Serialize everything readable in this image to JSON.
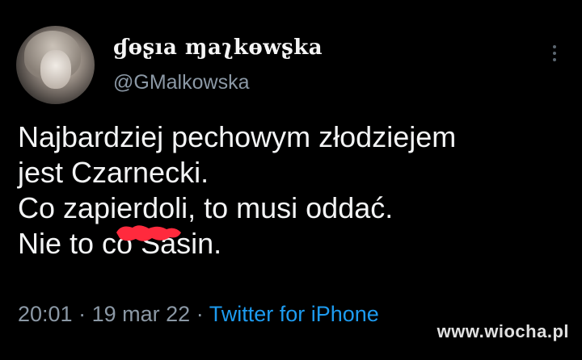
{
  "author": {
    "display_name": "ɠɵʂıa ɱaʅkɵwʂka",
    "handle": "@GMalkowska"
  },
  "tweet": {
    "lines": [
      "Najbardziej pechowym złodziejem",
      "jest Czarnecki.",
      "Co zapierdoli, to musi oddać.",
      "Nie to co Sasin."
    ],
    "censor_mark_color": "#ff2a3d",
    "time": "20:01",
    "date": "19 mar 22",
    "separator": "·",
    "source": "Twitter for iPhone"
  },
  "watermark": "www.wiocha.pl",
  "colors": {
    "background": "#000000",
    "text": "#f3f4f5",
    "secondary": "#8b98a5",
    "link": "#1d9bf0"
  },
  "icons": {
    "more": "more-vertical-icon"
  }
}
